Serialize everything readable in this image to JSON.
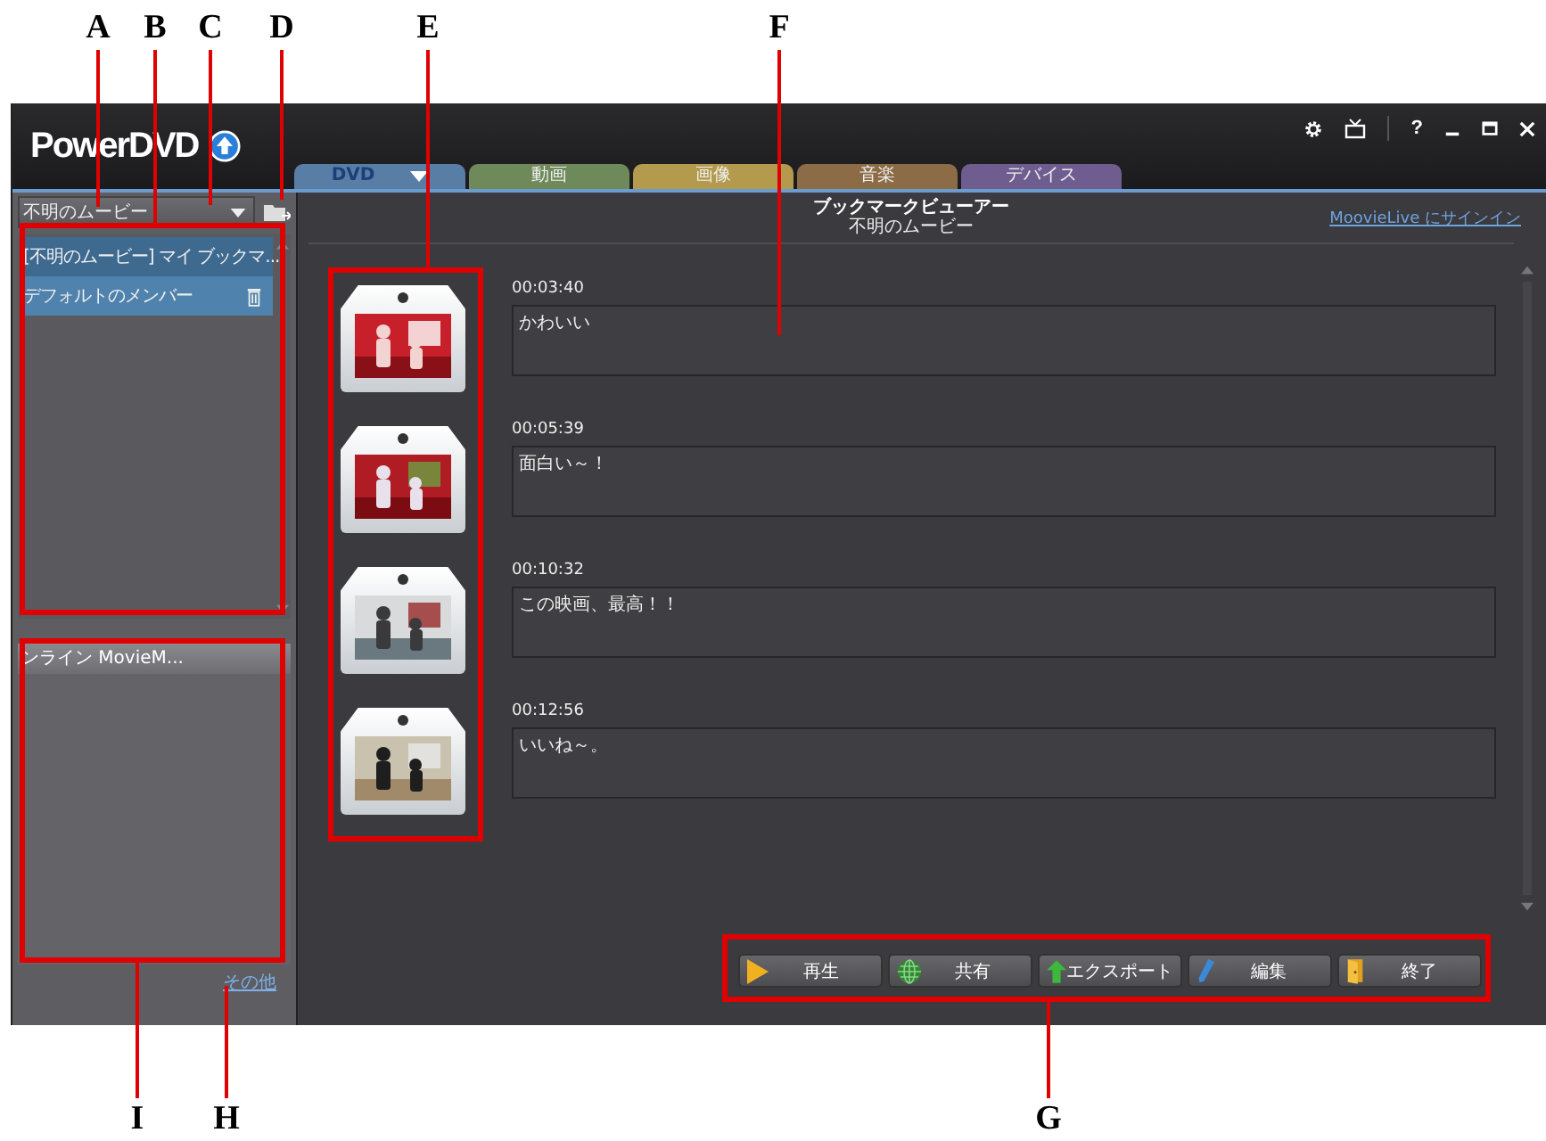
{
  "callouts_top": [
    "A",
    "B",
    "C",
    "D",
    "E",
    "F"
  ],
  "callouts_bottom": [
    "I",
    "H",
    "G"
  ],
  "app": {
    "logo": "PowerDVD",
    "window_controls": {
      "help": "?"
    },
    "tabs": [
      {
        "label": "DVD",
        "selected": true,
        "color": "#587ea6"
      },
      {
        "label": "動画",
        "selected": false,
        "color": "#6f8a5a"
      },
      {
        "label": "画像",
        "selected": false,
        "color": "#b39a4c"
      },
      {
        "label": "音楽",
        "selected": false,
        "color": "#8c6c47"
      },
      {
        "label": "デバイス",
        "selected": false,
        "color": "#6f5d90"
      }
    ],
    "sidebar": {
      "movie_select": {
        "value": "不明のムービー"
      },
      "bookmark_groups": [
        {
          "label": "[不明のムービー] マイ ブックマ...",
          "selected": false
        },
        {
          "label": "デフォルトのメンバー",
          "selected": true
        }
      ],
      "online_panel": {
        "header": "ンライン MovieM..."
      },
      "more_link": "その他"
    },
    "main": {
      "title": "ブックマークビューアー",
      "subtitle": "不明のムービー",
      "signin_link": "MoovieLive にサインイン",
      "bookmarks": [
        {
          "time": "00:03:40",
          "comment": "かわいい"
        },
        {
          "time": "00:05:39",
          "comment": "面白い～！"
        },
        {
          "time": "00:10:32",
          "comment": "この映画、最高！！"
        },
        {
          "time": "00:12:56",
          "comment": "いいね～。"
        }
      ],
      "buttons": [
        {
          "label": "再生",
          "kind": "play"
        },
        {
          "label": "共有",
          "kind": "share"
        },
        {
          "label": "エクスポート",
          "kind": "export"
        },
        {
          "label": "編集",
          "kind": "edit"
        },
        {
          "label": "終了",
          "kind": "exit"
        }
      ]
    }
  }
}
